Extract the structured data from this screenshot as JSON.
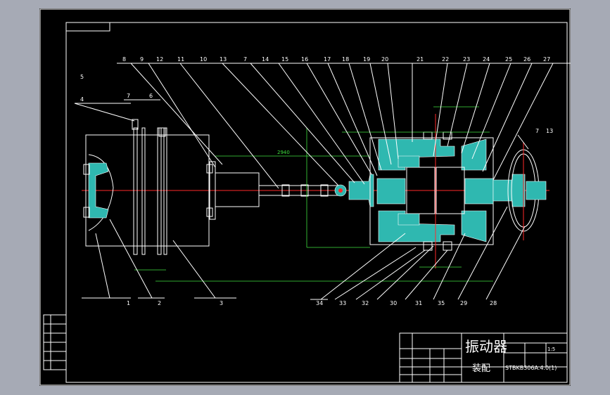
{
  "drawing": {
    "title": "振动器",
    "subtitle": "装配",
    "drawing_number": "STBKB306A.4.0(1)",
    "scale": "1:5"
  },
  "dimensions": {
    "shaft_length": "2940"
  },
  "callouts_top": [
    "8",
    "9",
    "12",
    "11",
    "10",
    "13",
    "7",
    "14",
    "15",
    "16",
    "17",
    "18",
    "19",
    "20",
    "21",
    "22",
    "23",
    "24",
    "25",
    "26",
    "27"
  ],
  "callouts_left": [
    "5",
    "4",
    "7",
    "6"
  ],
  "callouts_right": [
    "7",
    "13"
  ],
  "callouts_bottom": [
    "1",
    "2",
    "3",
    "34",
    "33",
    "32",
    "30",
    "31",
    "35",
    "29",
    "28"
  ],
  "colors": {
    "background": "#000000",
    "outline": "#ffffff",
    "dimension": "#3fe03f",
    "centerline": "#ff2a2a",
    "section": "#2fb8b0"
  }
}
